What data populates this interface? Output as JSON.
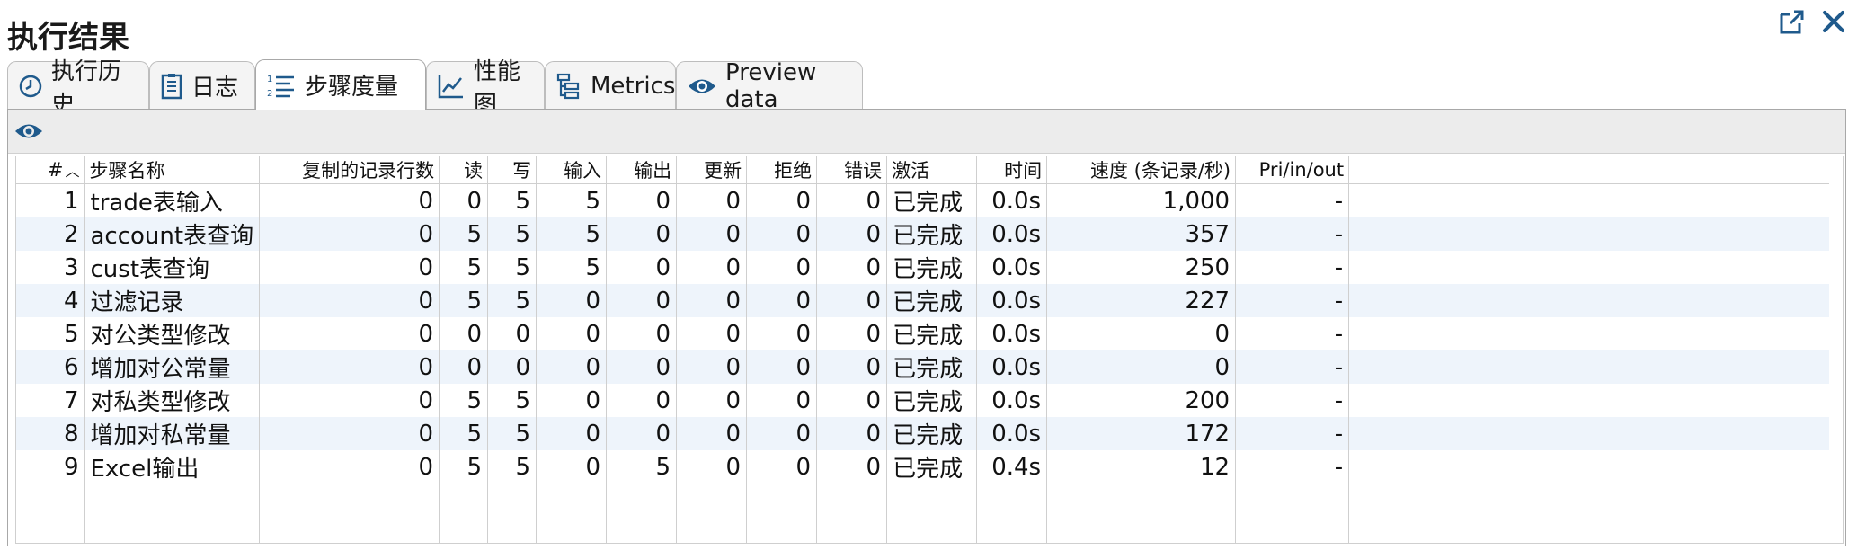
{
  "panel": {
    "title": "执行结果"
  },
  "tabs": [
    {
      "id": "history",
      "label": "执行历史",
      "icon": "clock-icon"
    },
    {
      "id": "log",
      "label": "日志",
      "icon": "document-icon"
    },
    {
      "id": "step-metrics",
      "label": "步骤度量",
      "icon": "numbered-list-icon",
      "active": true
    },
    {
      "id": "perf",
      "label": "性能图",
      "icon": "line-chart-icon"
    },
    {
      "id": "metrics",
      "label": "Metrics",
      "icon": "tree-icon"
    },
    {
      "id": "preview",
      "label": "Preview data",
      "icon": "eye-icon"
    }
  ],
  "table": {
    "columns": [
      "#",
      "步骤名称",
      "复制的记录行数",
      "读",
      "写",
      "输入",
      "输出",
      "更新",
      "拒绝",
      "错误",
      "激活",
      "时间",
      "速度 (条记录/秒)",
      "Pri/in/out"
    ],
    "rows": [
      [
        "1",
        "trade表输入",
        "0",
        "0",
        "5",
        "5",
        "0",
        "0",
        "0",
        "0",
        "已完成",
        "0.0s",
        "1,000",
        "-"
      ],
      [
        "2",
        "account表查询",
        "0",
        "5",
        "5",
        "5",
        "0",
        "0",
        "0",
        "0",
        "已完成",
        "0.0s",
        "357",
        "-"
      ],
      [
        "3",
        "cust表查询",
        "0",
        "5",
        "5",
        "5",
        "0",
        "0",
        "0",
        "0",
        "已完成",
        "0.0s",
        "250",
        "-"
      ],
      [
        "4",
        "过滤记录",
        "0",
        "5",
        "5",
        "0",
        "0",
        "0",
        "0",
        "0",
        "已完成",
        "0.0s",
        "227",
        "-"
      ],
      [
        "5",
        "对公类型修改",
        "0",
        "0",
        "0",
        "0",
        "0",
        "0",
        "0",
        "0",
        "已完成",
        "0.0s",
        "0",
        "-"
      ],
      [
        "6",
        "增加对公常量",
        "0",
        "0",
        "0",
        "0",
        "0",
        "0",
        "0",
        "0",
        "已完成",
        "0.0s",
        "0",
        "-"
      ],
      [
        "7",
        "对私类型修改",
        "0",
        "5",
        "5",
        "0",
        "0",
        "0",
        "0",
        "0",
        "已完成",
        "0.0s",
        "200",
        "-"
      ],
      [
        "8",
        "增加对私常量",
        "0",
        "5",
        "5",
        "0",
        "0",
        "0",
        "0",
        "0",
        "已完成",
        "0.0s",
        "172",
        "-"
      ],
      [
        "9",
        "Excel输出",
        "0",
        "5",
        "5",
        "0",
        "5",
        "0",
        "0",
        "0",
        "已完成",
        "0.4s",
        "12",
        "-"
      ]
    ]
  },
  "colors": {
    "row_alt": "#eef4fb",
    "accent": "#1f5a8c",
    "border": "#cfcfcf"
  }
}
